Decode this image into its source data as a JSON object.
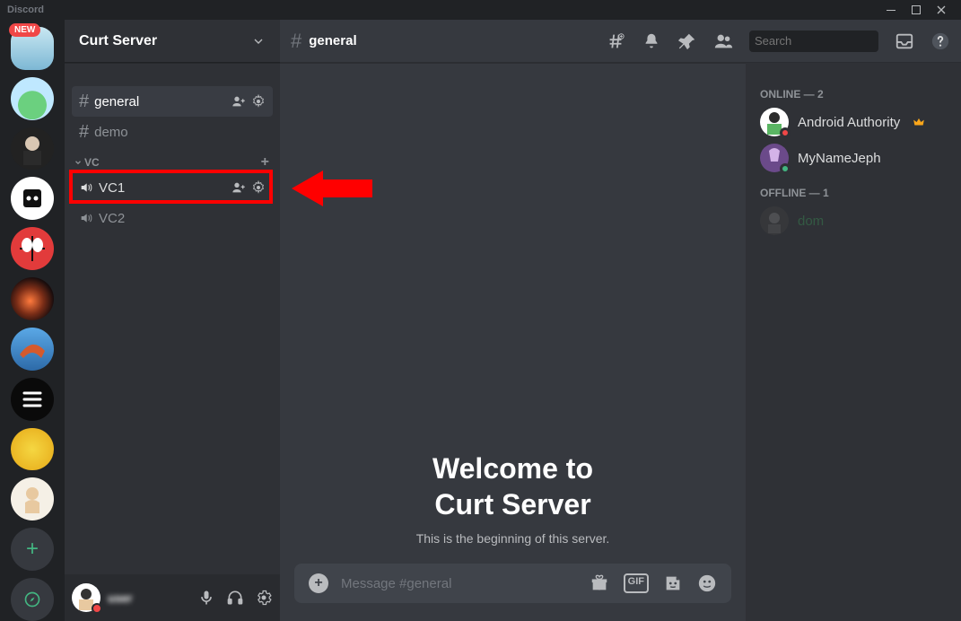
{
  "app": {
    "name": "Discord",
    "new_badge": "NEW"
  },
  "server": {
    "name": "Curt Server"
  },
  "channels": {
    "text": [
      {
        "name": "general",
        "selected": true
      },
      {
        "name": "demo",
        "selected": false
      }
    ],
    "voice_category": "VC",
    "voice": [
      {
        "name": "VC1",
        "highlighted": true
      },
      {
        "name": "VC2",
        "highlighted": false
      }
    ]
  },
  "header": {
    "channel": "general",
    "search_placeholder": "Search"
  },
  "welcome": {
    "line1": "Welcome to",
    "line2": "Curt Server",
    "sub": "This is the beginning of this server."
  },
  "compose": {
    "placeholder": "Message #general",
    "gif": "GIF"
  },
  "members": {
    "online_label": "ONLINE — 2",
    "offline_label": "OFFLINE — 1",
    "online": [
      {
        "name": "Android Authority",
        "status": "dnd",
        "crown": true,
        "color": "#ffffff"
      },
      {
        "name": "MyNameJeph",
        "status": "online",
        "crown": false,
        "color": "#ffffff"
      }
    ],
    "offline": [
      {
        "name": "dom",
        "color": "#3ba55c"
      }
    ]
  },
  "user_panel": {
    "name": "user"
  },
  "colors": {
    "dnd": "#f04747",
    "online": "#43b581",
    "offline": "#747f8d"
  }
}
